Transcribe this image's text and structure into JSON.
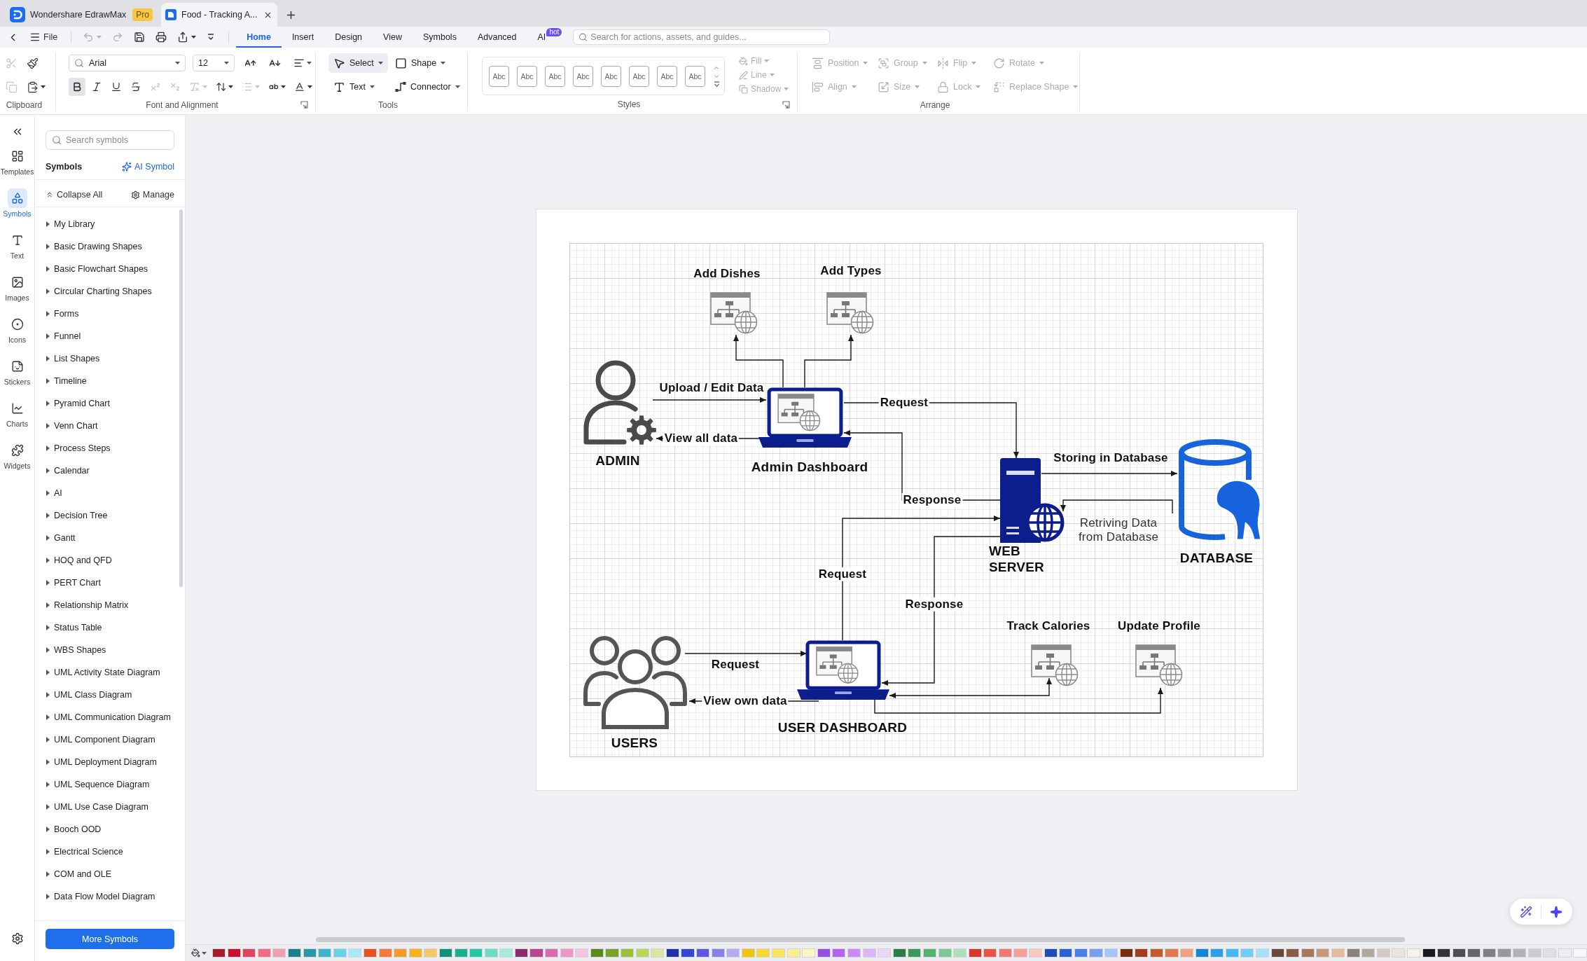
{
  "title_bar": {
    "tabs": [
      {
        "kind": "home",
        "label": "Wondershare EdrawMax",
        "badge": "Pro",
        "selected": false
      },
      {
        "kind": "document",
        "label": "Food - Tracking A...",
        "selected": true
      }
    ]
  },
  "menu_bar": {
    "file_label": "File",
    "quick_actions": [
      {
        "disabled": true
      },
      {
        "disabled": true
      },
      {
        "disabled": false
      },
      {
        "disabled": false
      },
      {
        "disabled": false
      },
      {
        "disabled": false
      }
    ],
    "tabs": [
      {
        "label": "Home",
        "selected": true
      },
      {
        "label": "Insert",
        "selected": false
      },
      {
        "label": "Design",
        "selected": false
      },
      {
        "label": "View",
        "selected": false
      },
      {
        "label": "Symbols",
        "selected": false
      },
      {
        "label": "Advanced",
        "selected": false
      },
      {
        "label": "AI",
        "selected": false,
        "badge": "hot"
      }
    ],
    "search": {
      "placeholder": "Search for actions, assets, and guides..."
    }
  },
  "ribbon": {
    "clipboard": {
      "label": "Clipboard",
      "buttons": [
        {
          "disabled": true
        },
        {
          "disabled": false
        },
        {
          "disabled": true
        },
        {
          "disabled": false
        }
      ]
    },
    "font": {
      "label": "Font and Alignment",
      "font_name": "Arial",
      "font_size": "12",
      "format_buttons": [
        {
          "on": true,
          "disabled": false
        },
        {
          "on": false,
          "disabled": false
        },
        {
          "on": false,
          "disabled": false
        },
        {
          "on": false,
          "disabled": false
        },
        {
          "on": false,
          "disabled": true
        },
        {
          "on": false,
          "disabled": true
        },
        {
          "on": false,
          "disabled": true
        },
        {
          "on": false,
          "disabled": false
        },
        {
          "on": false,
          "disabled": true
        },
        {
          "on": false,
          "disabled": false
        },
        {
          "on": false,
          "disabled": false
        }
      ]
    },
    "tools": {
      "label": "Tools",
      "items": [
        {
          "label": "Select",
          "selected": true
        },
        {
          "label": "Shape",
          "selected": false
        },
        {
          "label": "Text",
          "selected": false
        },
        {
          "label": "Connector",
          "selected": false
        }
      ]
    },
    "styles": {
      "label": "Styles",
      "presets": [
        "Abc",
        "Abc",
        "Abc",
        "Abc",
        "Abc",
        "Abc",
        "Abc",
        "Abc"
      ],
      "options": [
        {
          "label": "Fill",
          "disabled": true
        },
        {
          "label": "Line",
          "disabled": true
        },
        {
          "label": "Shadow",
          "disabled": true
        }
      ]
    },
    "arrange": {
      "label": "Arrange",
      "items": [
        {
          "label": "Position",
          "disabled": true
        },
        {
          "label": "Group",
          "disabled": true
        },
        {
          "label": "Flip",
          "disabled": true
        },
        {
          "label": "Rotate",
          "disabled": true
        },
        {
          "label": "Align",
          "disabled": true
        },
        {
          "label": "Size",
          "disabled": true
        },
        {
          "label": "Lock",
          "disabled": true
        },
        {
          "label": "Replace Shape",
          "disabled": true
        }
      ]
    }
  },
  "rail": {
    "items": [
      {
        "label": "Templates",
        "selected": false
      },
      {
        "label": "Symbols",
        "selected": true
      },
      {
        "label": "Text",
        "selected": false
      },
      {
        "label": "Images",
        "selected": false
      },
      {
        "label": "Icons",
        "selected": false
      },
      {
        "label": "Stickers",
        "selected": false
      },
      {
        "label": "Charts",
        "selected": false
      },
      {
        "label": "Widgets",
        "selected": false
      }
    ]
  },
  "symbols_panel": {
    "search": {
      "placeholder": "Search symbols"
    },
    "title": "Symbols",
    "ai_link": "AI Symbol",
    "collapse_all": "Collapse All",
    "manage": "Manage",
    "libraries": [
      {
        "label": "My Library",
        "expanded": false
      },
      {
        "label": "Basic Drawing Shapes",
        "expanded": false
      },
      {
        "label": "Basic Flowchart Shapes",
        "expanded": false
      },
      {
        "label": "Circular Charting Shapes",
        "expanded": false
      },
      {
        "label": "Forms",
        "expanded": false
      },
      {
        "label": "Funnel",
        "expanded": false
      },
      {
        "label": "List Shapes",
        "expanded": false
      },
      {
        "label": "Timeline",
        "expanded": false
      },
      {
        "label": "Pyramid Chart",
        "expanded": false
      },
      {
        "label": "Venn Chart",
        "expanded": false
      },
      {
        "label": "Process Steps",
        "expanded": false
      },
      {
        "label": "Calendar",
        "expanded": false
      },
      {
        "label": "AI",
        "expanded": false
      },
      {
        "label": "Decision Tree",
        "expanded": false
      },
      {
        "label": "Gantt",
        "expanded": false
      },
      {
        "label": "HOQ and QFD",
        "expanded": false
      },
      {
        "label": "PERT Chart",
        "expanded": false
      },
      {
        "label": "Relationship Matrix",
        "expanded": false
      },
      {
        "label": "Status Table",
        "expanded": false
      },
      {
        "label": "WBS Shapes",
        "expanded": false
      },
      {
        "label": "UML Activity State Diagram",
        "expanded": false
      },
      {
        "label": "UML Class Diagram",
        "expanded": false
      },
      {
        "label": "UML Communication Diagram",
        "expanded": false
      },
      {
        "label": "UML Component Diagram",
        "expanded": false
      },
      {
        "label": "UML Deployment Diagram",
        "expanded": false
      },
      {
        "label": "UML Sequence Diagram",
        "expanded": false
      },
      {
        "label": "UML Use Case Diagram",
        "expanded": false
      },
      {
        "label": "Booch OOD",
        "expanded": false
      },
      {
        "label": "Electrical Science",
        "expanded": false
      },
      {
        "label": "COM and OLE",
        "expanded": false
      },
      {
        "label": "Data Flow Model Diagram",
        "expanded": false
      }
    ],
    "more_button": "More Symbols"
  },
  "diagram": {
    "nodes": [
      {
        "kind": "page",
        "label": "Add Dishes"
      },
      {
        "kind": "page",
        "label": "Add Types"
      },
      {
        "kind": "admin",
        "label": "ADMIN"
      },
      {
        "kind": "laptop",
        "label": "Admin Dashboard"
      },
      {
        "kind": "server",
        "label": "WEB SERVER"
      },
      {
        "kind": "database",
        "label": "DATABASE"
      },
      {
        "kind": "page",
        "label": "Track Calories"
      },
      {
        "kind": "page",
        "label": "Update Profile"
      },
      {
        "kind": "group",
        "label": "USERS"
      },
      {
        "kind": "laptop",
        "label": "USER DASHBOARD"
      }
    ],
    "connectors": [
      {
        "arrow_start": false,
        "arrow_end": true
      },
      {
        "arrow_start": false,
        "arrow_end": true
      },
      {
        "label": "Upload / Edit Data",
        "arrow_start": false,
        "arrow_end": true
      },
      {
        "label": "View all data",
        "arrow_start": false,
        "arrow_end": true
      },
      {
        "label": "Request",
        "arrow_start": false,
        "arrow_end": true
      },
      {
        "label": "Response",
        "arrow_start": false,
        "arrow_end": true
      },
      {
        "label": "Storing in Database",
        "arrow_start": false,
        "arrow_end": true
      },
      {
        "label": "Retriving Data from Database",
        "arrow_start": false,
        "arrow_end": true
      },
      {
        "label": "Request",
        "arrow_start": false,
        "arrow_end": true
      },
      {
        "label": "Response",
        "arrow_start": false,
        "arrow_end": true
      },
      {
        "label": "Request",
        "arrow_start": false,
        "arrow_end": true
      },
      {
        "label": "View own data",
        "arrow_start": false,
        "arrow_end": true
      },
      {
        "arrow_start": true,
        "arrow_end": true
      },
      {
        "arrow_start": false,
        "arrow_end": true
      }
    ]
  },
  "palette": [
    {
      "color": "#a51d2d"
    },
    {
      "color": "#c8102e"
    },
    {
      "color": "#e0445e"
    },
    {
      "color": "#ee6d85"
    },
    {
      "color": "#f49fb0"
    },
    {
      "color": "#1b7e8a"
    },
    {
      "color": "#2a97a8"
    },
    {
      "color": "#3cb5cc"
    },
    {
      "color": "#64d3e8"
    },
    {
      "color": "#a9e9f3"
    },
    {
      "color": "#e5521f"
    },
    {
      "color": "#f27a3b"
    },
    {
      "color": "#f69a2c"
    },
    {
      "color": "#f6b320"
    },
    {
      "color": "#f5c76a"
    },
    {
      "color": "#12907a"
    },
    {
      "color": "#17b192"
    },
    {
      "color": "#22c7a3"
    },
    {
      "color": "#6bdcc5"
    },
    {
      "color": "#a6ecdc"
    },
    {
      "color": "#8c2a6a"
    },
    {
      "color": "#b8458f"
    },
    {
      "color": "#d96ab0"
    },
    {
      "color": "#ee96c9"
    },
    {
      "color": "#f5c4de"
    },
    {
      "color": "#5a8a19"
    },
    {
      "color": "#78a22b"
    },
    {
      "color": "#9bc13a"
    },
    {
      "color": "#bad65b"
    },
    {
      "color": "#d7e79f"
    },
    {
      "color": "#2233a6"
    },
    {
      "color": "#3446d2"
    },
    {
      "color": "#5b58e2"
    },
    {
      "color": "#8b80ea"
    },
    {
      "color": "#b4a9f2"
    },
    {
      "color": "#f1c40f"
    },
    {
      "color": "#f7d731"
    },
    {
      "color": "#f9e35c"
    },
    {
      "color": "#fbee8e"
    },
    {
      "color": "#fdf6c2"
    },
    {
      "color": "#9a4ee0"
    },
    {
      "color": "#b464f0"
    },
    {
      "color": "#c98cf6"
    },
    {
      "color": "#dcb4f8"
    },
    {
      "color": "#ecd7fb"
    },
    {
      "color": "#2d7c45"
    },
    {
      "color": "#3b9a59"
    },
    {
      "color": "#51b271"
    },
    {
      "color": "#7cc994"
    },
    {
      "color": "#acdfba"
    },
    {
      "color": "#d8392a"
    },
    {
      "color": "#e95444"
    },
    {
      "color": "#f07a6b"
    },
    {
      "color": "#f5a096"
    },
    {
      "color": "#f9c8c1"
    },
    {
      "color": "#1f4eb3"
    },
    {
      "color": "#2a61d3"
    },
    {
      "color": "#4a7ee8"
    },
    {
      "color": "#78a0f0"
    },
    {
      "color": "#a8c3f6"
    },
    {
      "color": "#7a2d0b"
    },
    {
      "color": "#a03f1a"
    },
    {
      "color": "#c55a2e"
    },
    {
      "color": "#de7a4e"
    },
    {
      "color": "#eea17e"
    },
    {
      "color": "#1585d5"
    },
    {
      "color": "#2aa0e6"
    },
    {
      "color": "#48b8f0"
    },
    {
      "color": "#70cdf6"
    },
    {
      "color": "#a5e2fa"
    },
    {
      "color": "#6a4838"
    },
    {
      "color": "#8a5c46"
    },
    {
      "color": "#a8785c"
    },
    {
      "color": "#c89878"
    },
    {
      "color": "#e4bc9c"
    },
    {
      "color": "#8b8178"
    },
    {
      "color": "#b1a999"
    },
    {
      "color": "#d3ccbe"
    },
    {
      "color": "#ebe5d9"
    },
    {
      "color": "#f7f3ea"
    },
    {
      "color": "#1b1b1b"
    },
    {
      "color": "#333333"
    },
    {
      "color": "#4d4d4d"
    },
    {
      "color": "#666666"
    },
    {
      "color": "#808080"
    },
    {
      "color": "#999999"
    },
    {
      "color": "#b3b3b3"
    },
    {
      "color": "#cccccc"
    },
    {
      "color": "#e0e0e0"
    },
    {
      "color": "#eeeeee"
    },
    {
      "color": "#f8f8f8"
    }
  ]
}
